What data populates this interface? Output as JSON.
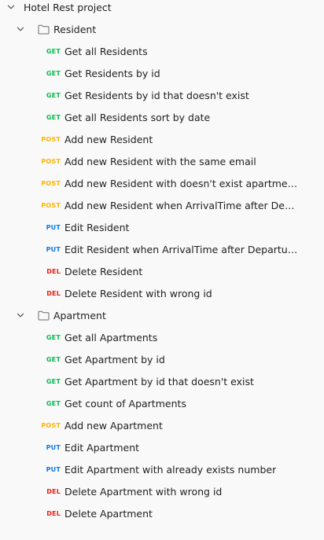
{
  "colors": {
    "get": "#0cbb52",
    "post": "#ffb400",
    "put": "#097bed",
    "del": "#eb2013"
  },
  "project": {
    "name": "Hotel Rest project",
    "icon": "chevron-down-icon"
  },
  "folders": [
    {
      "name": "Resident",
      "requests": [
        {
          "method": "GET",
          "label": "Get all Residents"
        },
        {
          "method": "GET",
          "label": "Get Residents by id"
        },
        {
          "method": "GET",
          "label": "Get Residents by id that doesn't exist"
        },
        {
          "method": "GET",
          "label": "Get all Residents sort by date"
        },
        {
          "method": "POST",
          "label": "Add new Resident"
        },
        {
          "method": "POST",
          "label": "Add new Resident with the same email"
        },
        {
          "method": "POST",
          "label": "Add new Resident with doesn't exist apartment's n..."
        },
        {
          "method": "POST",
          "label": "Add new Resident when ArrivalTime after Departu..."
        },
        {
          "method": "PUT",
          "label": "Edit Resident"
        },
        {
          "method": "PUT",
          "label": "Edit Resident when ArrivalTime after DepartureTime"
        },
        {
          "method": "DEL",
          "label": "Delete Resident"
        },
        {
          "method": "DEL",
          "label": "Delete Resident with wrong id"
        }
      ]
    },
    {
      "name": "Apartment",
      "requests": [
        {
          "method": "GET",
          "label": "Get all Apartments"
        },
        {
          "method": "GET",
          "label": "Get Apartment by id"
        },
        {
          "method": "GET",
          "label": "Get Apartment by id that doesn't exist"
        },
        {
          "method": "GET",
          "label": "Get count of Apartments"
        },
        {
          "method": "POST",
          "label": "Add new Apartment"
        },
        {
          "method": "PUT",
          "label": "Edit Apartment"
        },
        {
          "method": "PUT",
          "label": "Edit Apartment with already exists number"
        },
        {
          "method": "DEL",
          "label": "Delete Apartment with wrong id"
        },
        {
          "method": "DEL",
          "label": "Delete Apartment"
        }
      ]
    }
  ]
}
